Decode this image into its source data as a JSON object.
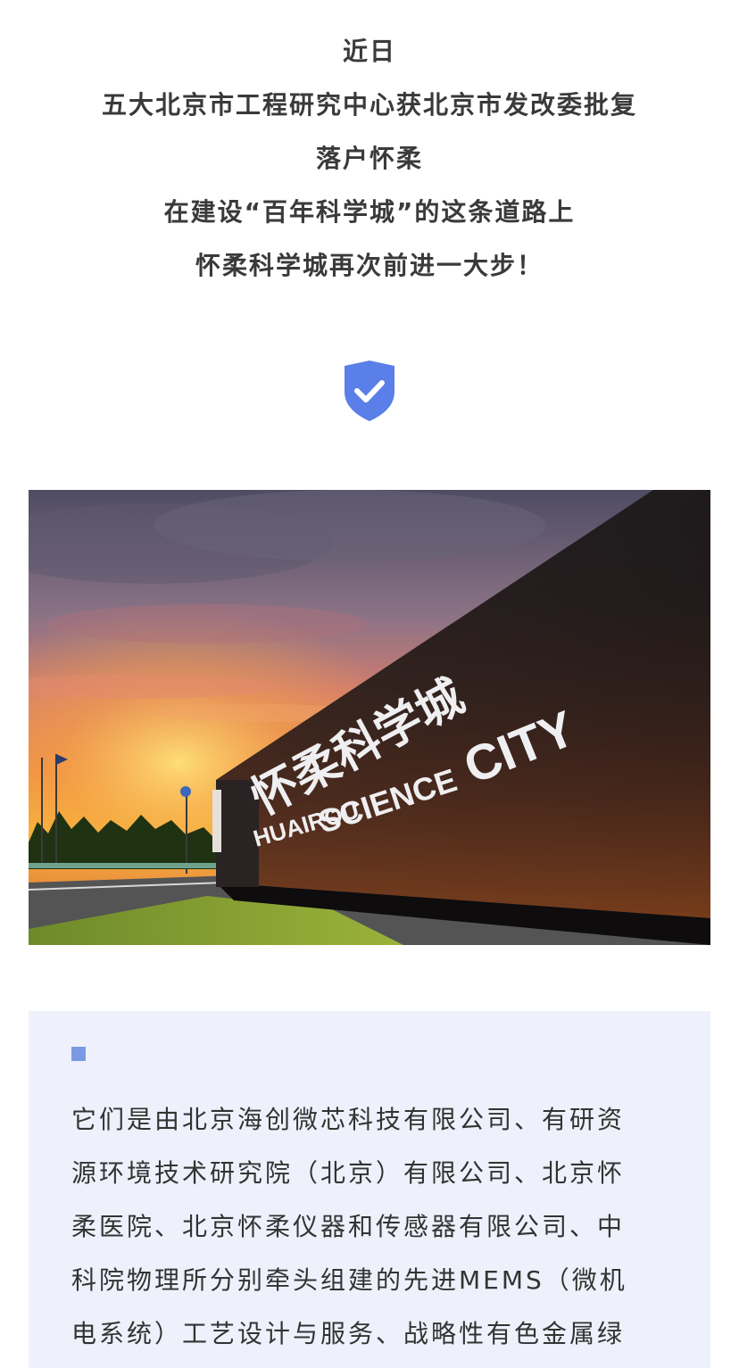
{
  "intro": {
    "lines": [
      "近日",
      "五大北京市工程研究中心获北京市发改委批复",
      "落户怀柔",
      "在建设“百年科学城”的这条道路上",
      "怀柔科学城再次前进一大步！"
    ]
  },
  "divider_icon": "shield-check-icon",
  "hero_photo": {
    "sign_chinese": "怀柔科学城",
    "sign_english": [
      "HUAIROU",
      "SCIENCE",
      "CITY"
    ]
  },
  "card": {
    "lines": [
      "它们是由北京海创微芯科技有限公司、有研资",
      "源环境技术研究院（北京）有限公司、北京怀",
      "柔医院、北京怀柔仪器和传感器有限公司、中",
      "科院物理所分别牵头组建的先进MEMS（微机",
      "电系统）工艺设计与服务、战略性有色金属绿"
    ]
  },
  "colors": {
    "accent": "#5b7fe8",
    "card_bg": "#eef1fb",
    "bullet": "#7a9be3",
    "text": "#333333"
  }
}
